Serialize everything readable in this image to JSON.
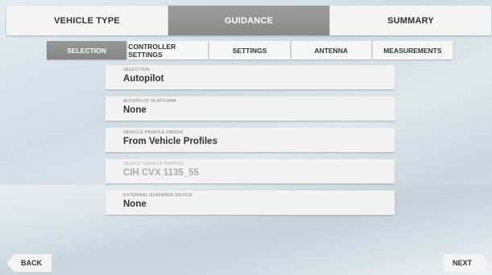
{
  "top_tabs": [
    {
      "label": "VEHICLE TYPE",
      "active": false
    },
    {
      "label": "GUIDANCE",
      "active": true
    },
    {
      "label": "SUMMARY",
      "active": false
    }
  ],
  "sub_tabs": [
    {
      "label": "SELECTION",
      "active": true
    },
    {
      "label": "CONTROLLER SETTINGS",
      "active": false
    },
    {
      "label": "SETTINGS",
      "active": false
    },
    {
      "label": "ANTENNA",
      "active": false
    },
    {
      "label": "MEASUREMENTS",
      "active": false
    }
  ],
  "fields": [
    {
      "label": "SELECTION",
      "value": "Autopilot",
      "disabled": false
    },
    {
      "label": "AUTOPILOT PLATFORM",
      "value": "None",
      "disabled": false
    },
    {
      "label": "VEHICLE PROFILE ORIGIN",
      "value": "From Vehicle Profiles",
      "disabled": false
    },
    {
      "label": "SELECT VEHICLE PROFILE",
      "value": "CIH CVX 1135_55",
      "disabled": true
    },
    {
      "label": "EXTERNAL GUIDANCE DEVICE",
      "value": "None",
      "disabled": false
    }
  ],
  "nav": {
    "back_label": "BACK",
    "next_label": "NEXT"
  },
  "colors": {
    "active_tab": "#8f8f8f",
    "tab_bg": "#f4f4f4"
  }
}
